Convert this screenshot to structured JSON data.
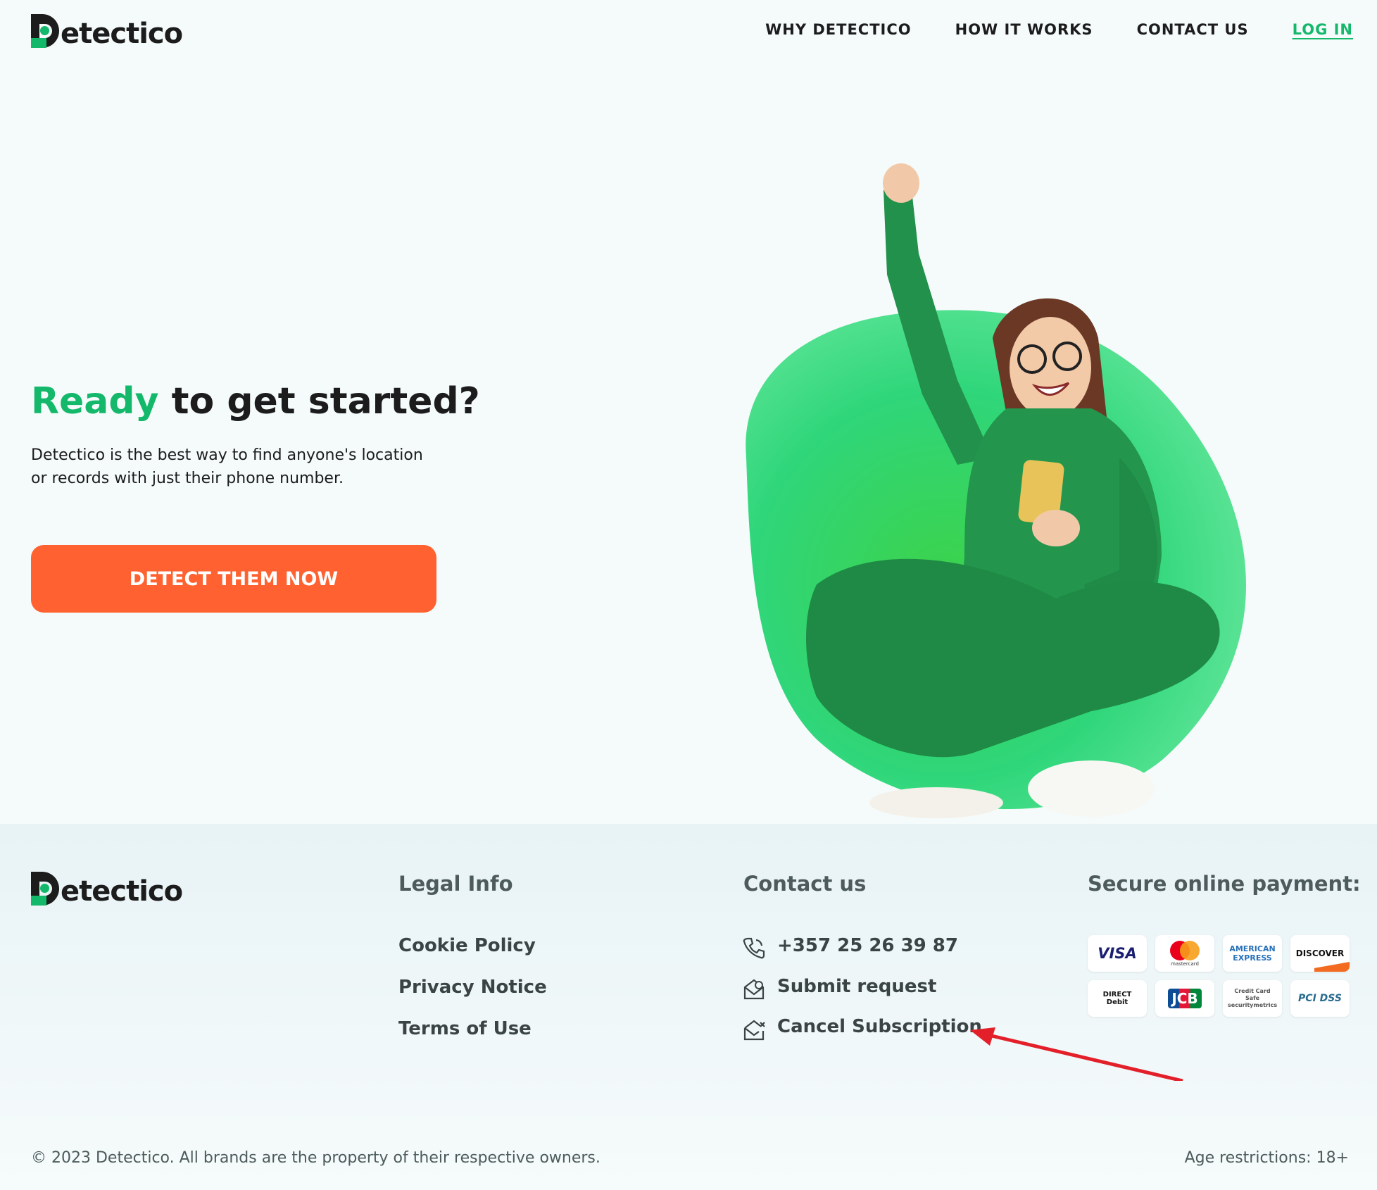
{
  "brand": {
    "name": "etectico",
    "green": "#14b86a",
    "orange": "#ff6230",
    "dark": "#1c1c1c"
  },
  "nav": {
    "items": [
      "WHY DETECTICO",
      "HOW IT WORKS",
      "CONTACT US"
    ],
    "login": "LOG IN"
  },
  "hero": {
    "title_accent": "Ready",
    "title_rest": " to get started?",
    "subtitle": "Detectico is the best way to find anyone's location or records with just their phone number.",
    "cta": "DETECT THEM NOW"
  },
  "footer": {
    "legal": {
      "title": "Legal Info",
      "links": [
        "Cookie Policy",
        "Privacy Notice",
        "Terms of Use"
      ]
    },
    "contact": {
      "title": "Contact us",
      "phone": "+357 25 26 39 87",
      "submit": "Submit request",
      "cancel": "Cancel Subscription"
    },
    "payment": {
      "title": "Secure online payment:",
      "row1": [
        "VISA",
        "mastercard",
        "AMERICAN EXPRESS",
        "DISCOVER"
      ],
      "row2": [
        "DIRECT Debit",
        "JCB",
        "Credit Card Safe securitymetrics",
        "PCI DSS"
      ]
    },
    "copyright": "© 2023 Detectico. All brands are the property of their respective owners.",
    "age": "Age restrictions: 18+"
  }
}
